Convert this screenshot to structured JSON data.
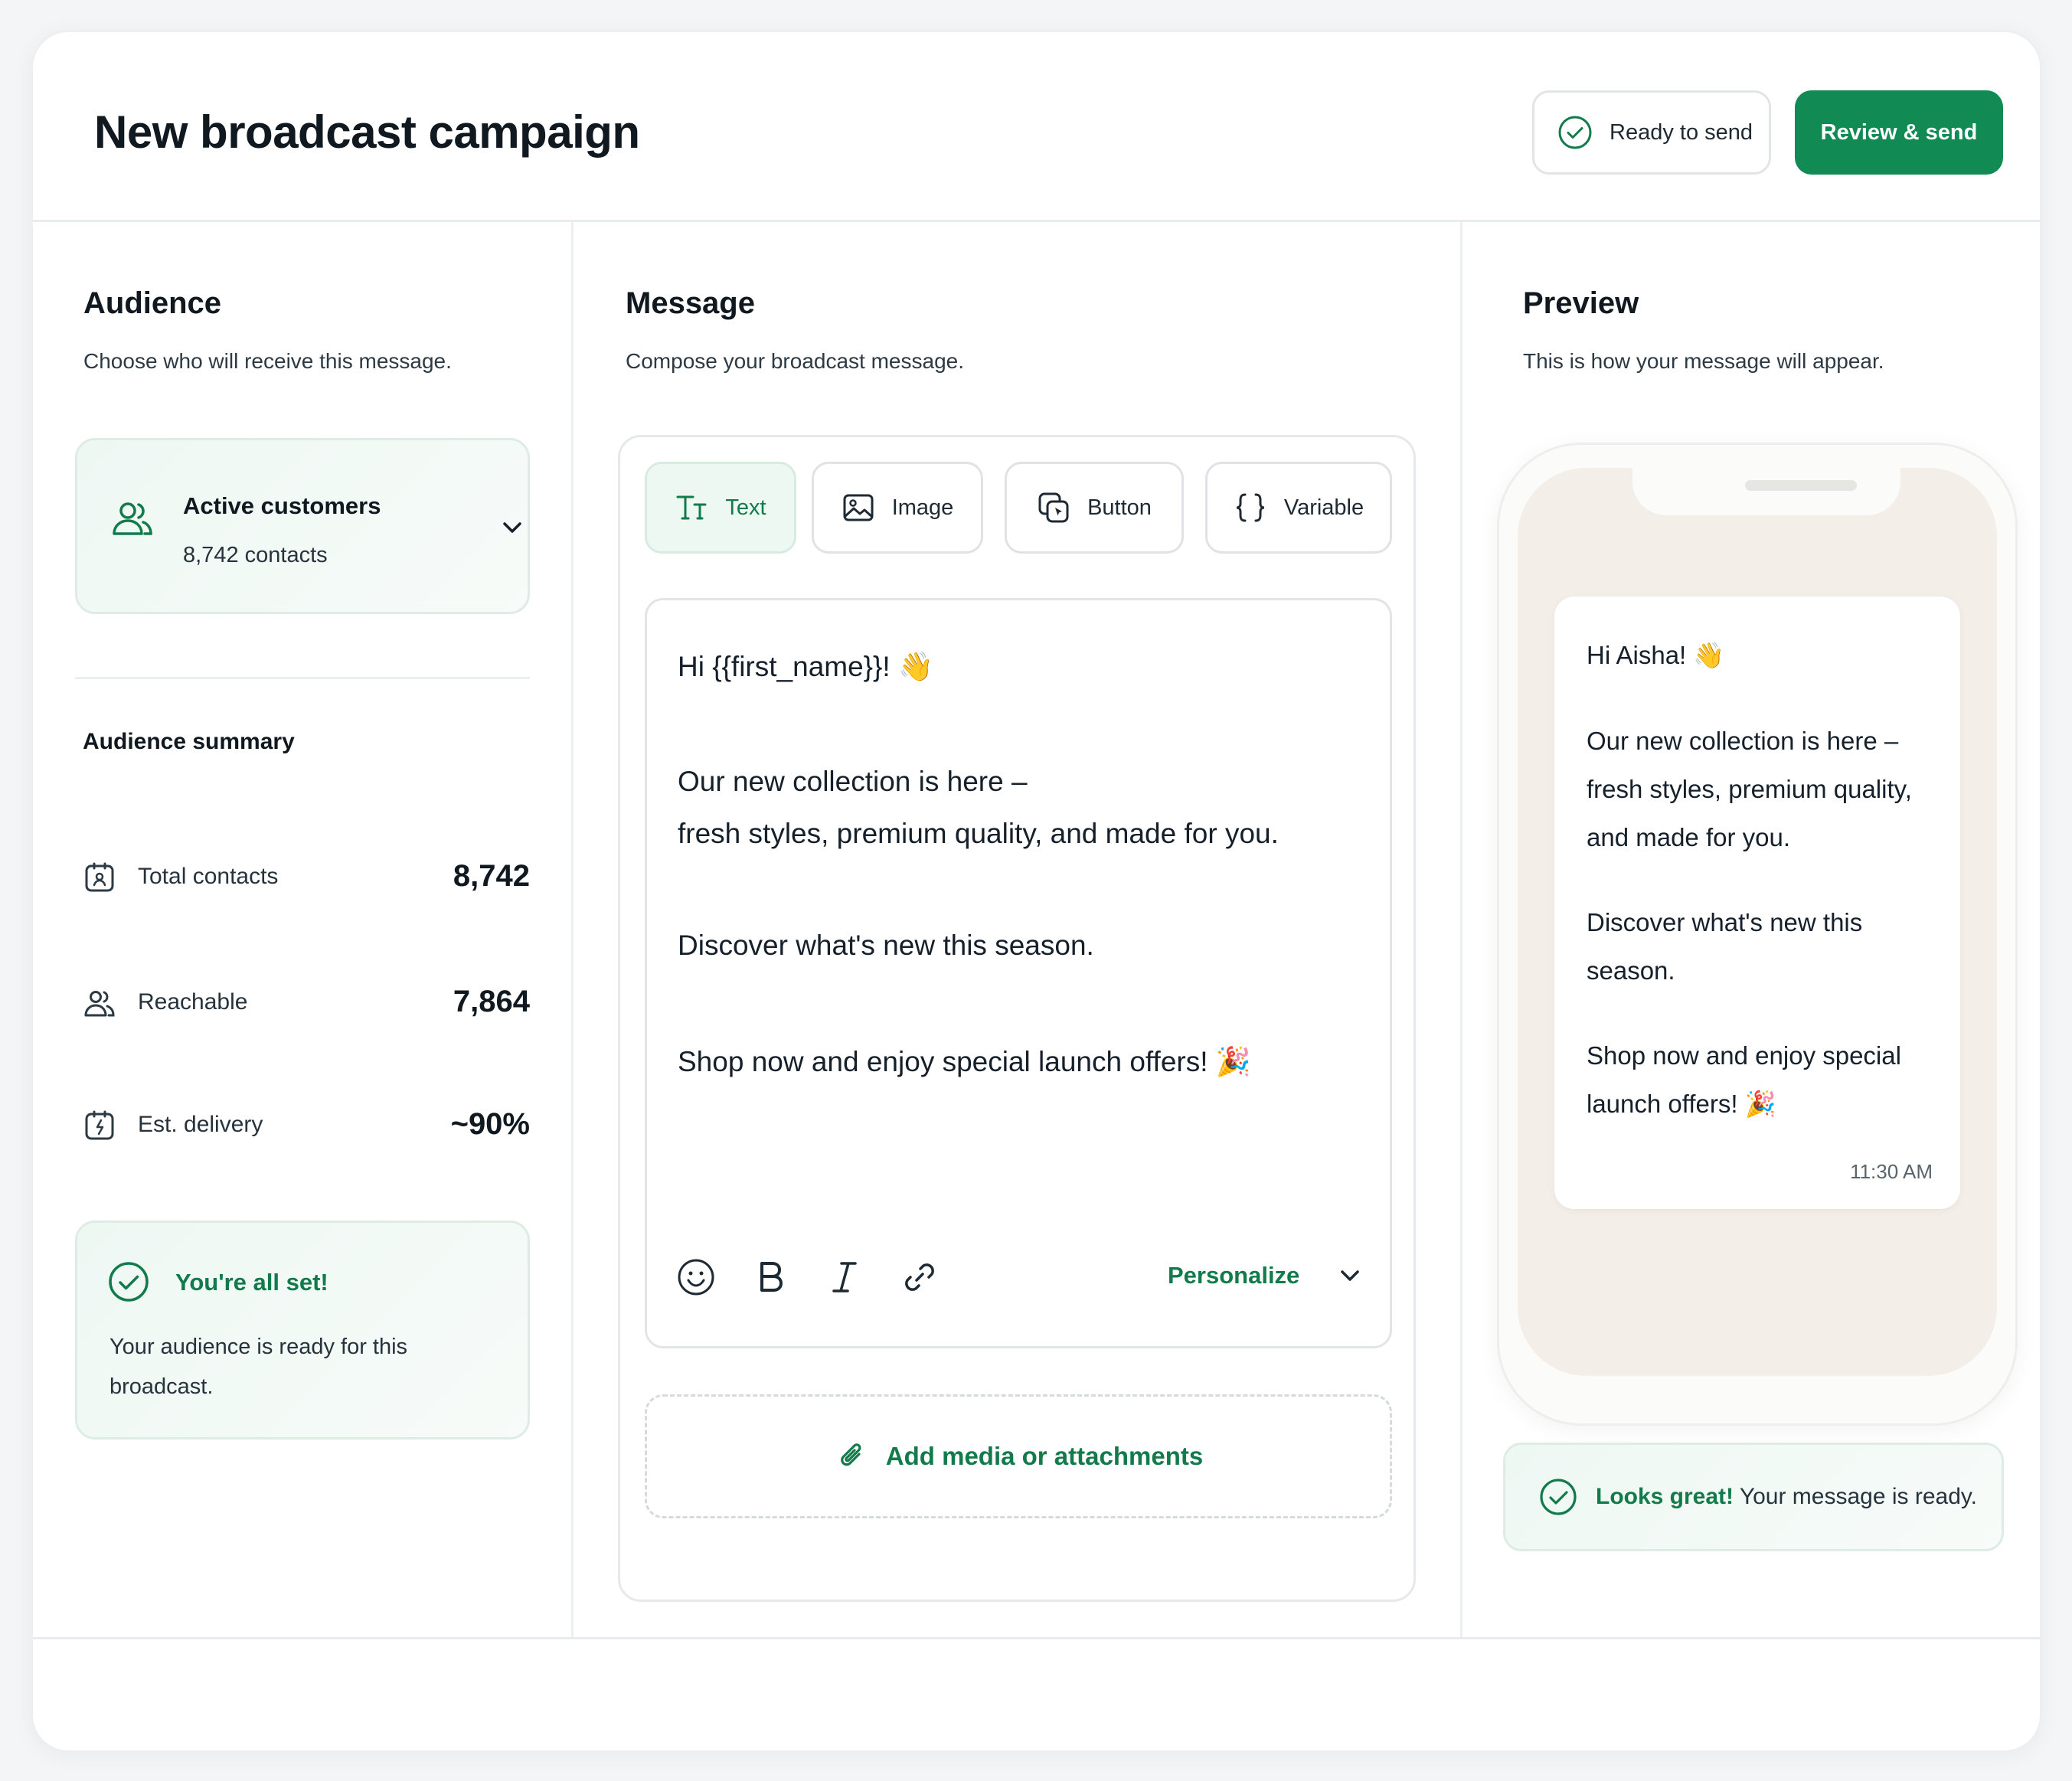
{
  "header": {
    "title": "New broadcast campaign",
    "status_label": "Ready to send",
    "primary_label": "Review & send"
  },
  "audience": {
    "title": "Audience",
    "subtitle": "Choose who will receive this message.",
    "segment": {
      "name": "Active customers",
      "count": "8,742 contacts"
    },
    "summary_title": "Audience summary",
    "stats": [
      {
        "label": "Total contacts",
        "value": "8,742"
      },
      {
        "label": "Reachable",
        "value": "7,864"
      },
      {
        "label": "Est. delivery",
        "value": "~90%"
      }
    ],
    "ready": {
      "title": "You're all set!",
      "text": "Your audience is ready for this broadcast."
    }
  },
  "message": {
    "title": "Message",
    "subtitle": "Compose your broadcast message.",
    "tools": [
      "Text",
      "Image",
      "Button",
      "Variable"
    ],
    "lines": [
      "Hi {{first_name}}! 👋",
      "Our new collection is here –",
      "fresh styles, premium quality, and made for you.",
      "Discover what's new this season.",
      "Shop now and enjoy special launch offers! 🎉"
    ],
    "personalize_label": "Personalize",
    "attach_label": "Add media or attachments"
  },
  "preview": {
    "title": "Preview",
    "subtitle": "This is how your message will appear.",
    "lines": [
      "Hi Aisha! 👋",
      "Our new collection is here –",
      "fresh styles, premium quality,",
      "and made for you.",
      "Discover what's new this",
      "season.",
      "Shop now and enjoy special",
      "launch offers! 🎉"
    ],
    "time": "11:30 AM",
    "status_bold": "Looks great!",
    "status_text": " Your message is ready."
  },
  "colors": {
    "accent": "#128a54",
    "accent_text": "#137a4b",
    "tint": "#eef8f3"
  }
}
